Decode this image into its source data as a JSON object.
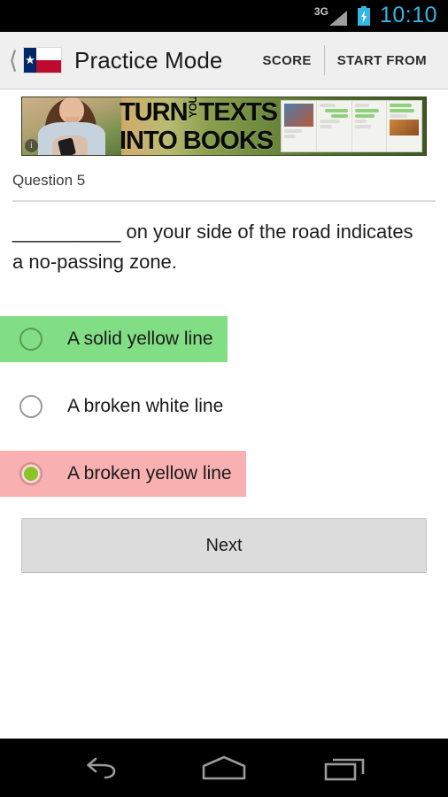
{
  "status_bar": {
    "network": "3G",
    "time": "10:10",
    "battery_icon": "battery-charging-icon",
    "signal_icon": "signal-bars-icon",
    "time_color": "#33b5e5"
  },
  "action_bar": {
    "back_icon": "back-chevron-icon",
    "app_icon": "texas-flag-icon",
    "title": "Practice Mode",
    "actions": [
      {
        "label": "SCORE",
        "name": "score-action"
      },
      {
        "label": "START FROM",
        "name": "start-from-action"
      }
    ]
  },
  "ad": {
    "line1": "TURN",
    "rotated_word": "YOUR",
    "line1b": "TEXTS",
    "line2": "INTO BOOKS",
    "info_badge": "i",
    "photo_alt": "woman-texting-photo",
    "book_alt": "open-book-pages-photo"
  },
  "question": {
    "label": "Question 5",
    "text": "__________ on your side of the road indicates a no-passing zone.",
    "options": [
      {
        "label": "A solid yellow line",
        "state": "correct",
        "selected": false,
        "background": "#82de85"
      },
      {
        "label": "A broken white line",
        "state": "neutral",
        "selected": false,
        "background": "#ffffff"
      },
      {
        "label": "A broken yellow line",
        "state": "wrong",
        "selected": true,
        "background": "#f9b0b0"
      }
    ]
  },
  "next_button": {
    "label": "Next"
  },
  "nav_bar": {
    "buttons": [
      {
        "name": "nav-back-button",
        "icon": "back-arrow-icon"
      },
      {
        "name": "nav-home-button",
        "icon": "home-icon"
      },
      {
        "name": "nav-recents-button",
        "icon": "recent-apps-icon"
      }
    ]
  }
}
